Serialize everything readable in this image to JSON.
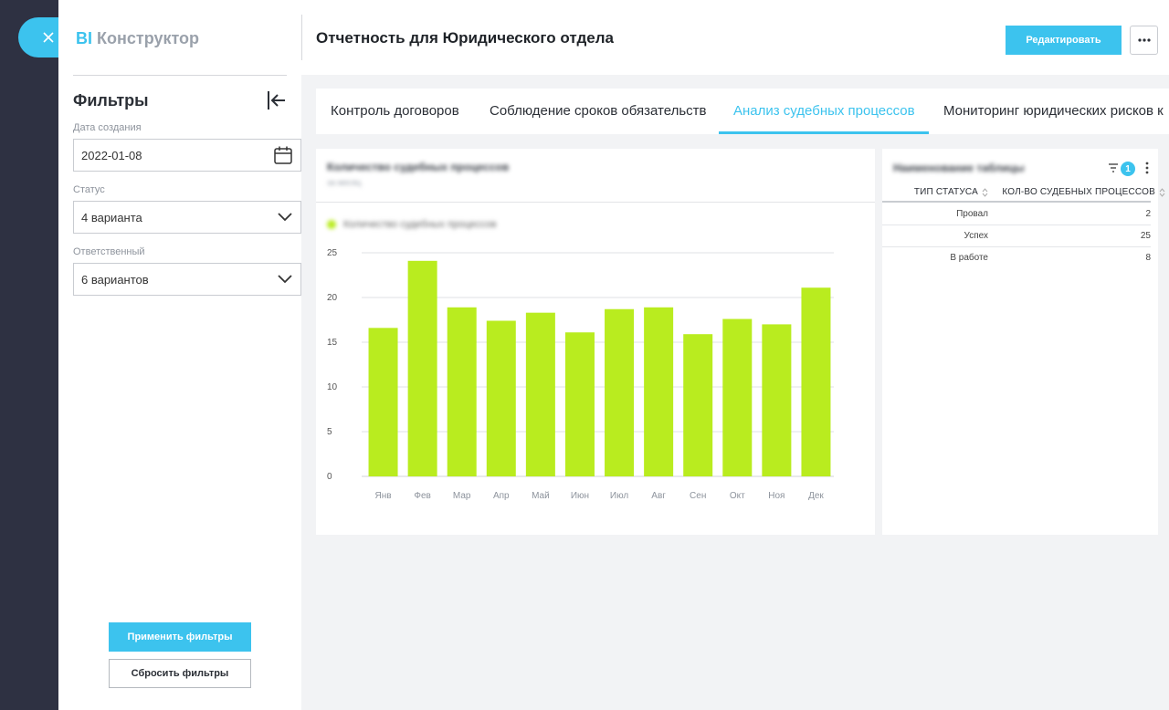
{
  "brand": {
    "prefix": "BI",
    "name": "Конструктор"
  },
  "filters": {
    "title": "Фильтры",
    "date": {
      "label": "Дата создания",
      "value": "2022-01-08"
    },
    "status": {
      "label": "Статус",
      "value": "4 варианта"
    },
    "responsible": {
      "label": "Ответственный",
      "value": "6 вариантов"
    },
    "apply_label": "Применить фильтры",
    "reset_label": "Сбросить фильтры"
  },
  "header": {
    "title": "Отчетность для Юридического отдела",
    "edit_label": "Редактировать"
  },
  "tabs": [
    {
      "label": "Контроль договоров",
      "active": false
    },
    {
      "label": "Соблюдение сроков обязательств",
      "active": false
    },
    {
      "label": "Анализ судебных процессов",
      "active": true
    },
    {
      "label": "Мониторинг юридических рисков к",
      "active": false
    }
  ],
  "chart_card": {
    "title": "Количество судебных процессов",
    "subtitle": "за месяц",
    "legend": "Количество судебных процессов"
  },
  "chart_data": {
    "type": "bar",
    "categories": [
      "Янв",
      "Фев",
      "Мар",
      "Апр",
      "Май",
      "Июн",
      "Июл",
      "Авг",
      "Сен",
      "Окт",
      "Ноя",
      "Дек"
    ],
    "series": [
      {
        "name": "Количество судебных процессов",
        "values": [
          16.6,
          24.1,
          18.9,
          17.4,
          18.3,
          16.1,
          18.7,
          18.9,
          15.9,
          17.6,
          17.0,
          21.1
        ],
        "color": "#b9ec1f"
      }
    ],
    "ylim": [
      0,
      25
    ],
    "yticks": [
      0,
      5,
      10,
      15,
      20,
      25
    ],
    "grid": true,
    "legend_position": "top-left"
  },
  "table_card": {
    "title": "Наименование таблицы",
    "filter_count": "1",
    "columns": [
      "ТИП СТАТУСА",
      "КОЛ-ВО СУДЕБНЫХ ПРОЦЕССОВ"
    ],
    "rows": [
      {
        "status": "Провал",
        "count": "2"
      },
      {
        "status": "Успех",
        "count": "25"
      },
      {
        "status": "В работе",
        "count": "8"
      }
    ]
  },
  "colors": {
    "accent": "#3cc3ee",
    "bar": "#b9ec1f",
    "rail": "#2e3142"
  }
}
